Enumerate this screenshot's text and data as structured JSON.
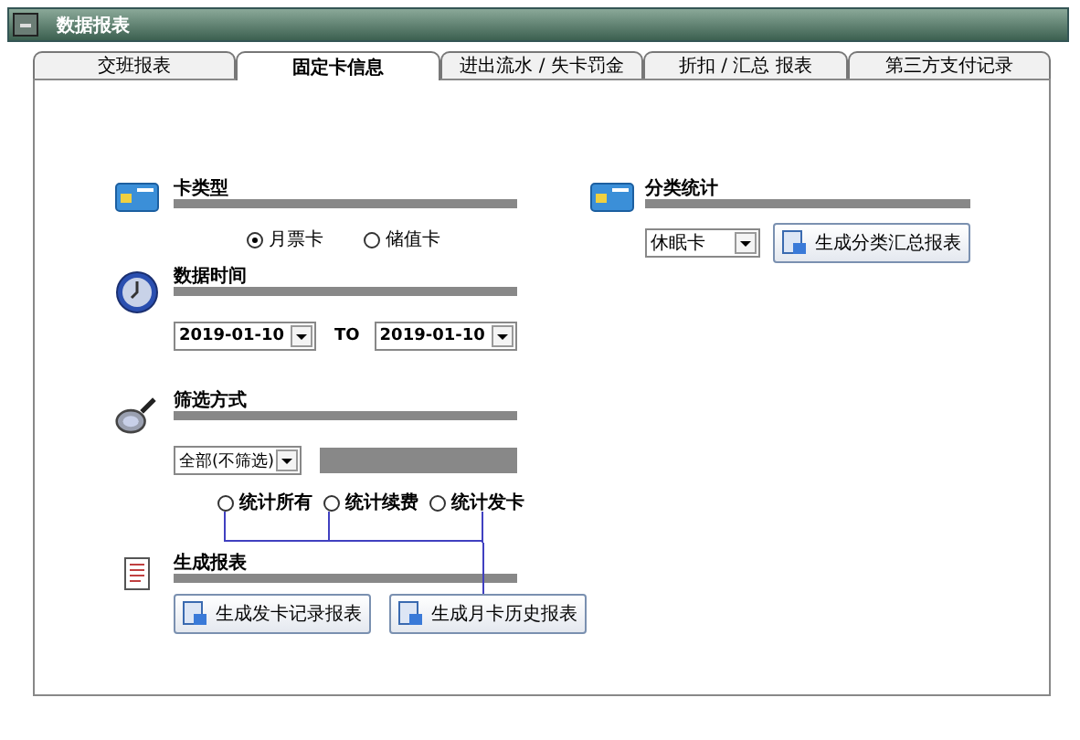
{
  "window": {
    "title": "数据报表"
  },
  "tabs": [
    {
      "label": "交班报表",
      "selected": false
    },
    {
      "label": "固定卡信息",
      "selected": true
    },
    {
      "label": "进出流水 / 失卡罚金",
      "selected": false
    },
    {
      "label": "折扣 / 汇总 报表",
      "selected": false
    },
    {
      "label": "第三方支付记录",
      "selected": false
    }
  ],
  "card_type": {
    "title": "卡类型",
    "options": [
      {
        "label": "月票卡",
        "selected": true
      },
      {
        "label": "储值卡",
        "selected": false
      }
    ]
  },
  "date_range": {
    "title": "数据时间",
    "from": "2019-01-10",
    "separator": "TO",
    "to": "2019-01-10"
  },
  "filter": {
    "title": "筛选方式",
    "mode": "全部(不筛选)",
    "options": [
      {
        "label": "统计所有",
        "selected": false
      },
      {
        "label": "统计续费",
        "selected": false
      },
      {
        "label": "统计发卡",
        "selected": false
      }
    ]
  },
  "report": {
    "title": "生成报表",
    "buttons": [
      "生成发卡记录报表",
      "生成月卡历史报表"
    ]
  },
  "category": {
    "title": "分类统计",
    "type": "休眠卡",
    "button": "生成分类汇总报表"
  }
}
